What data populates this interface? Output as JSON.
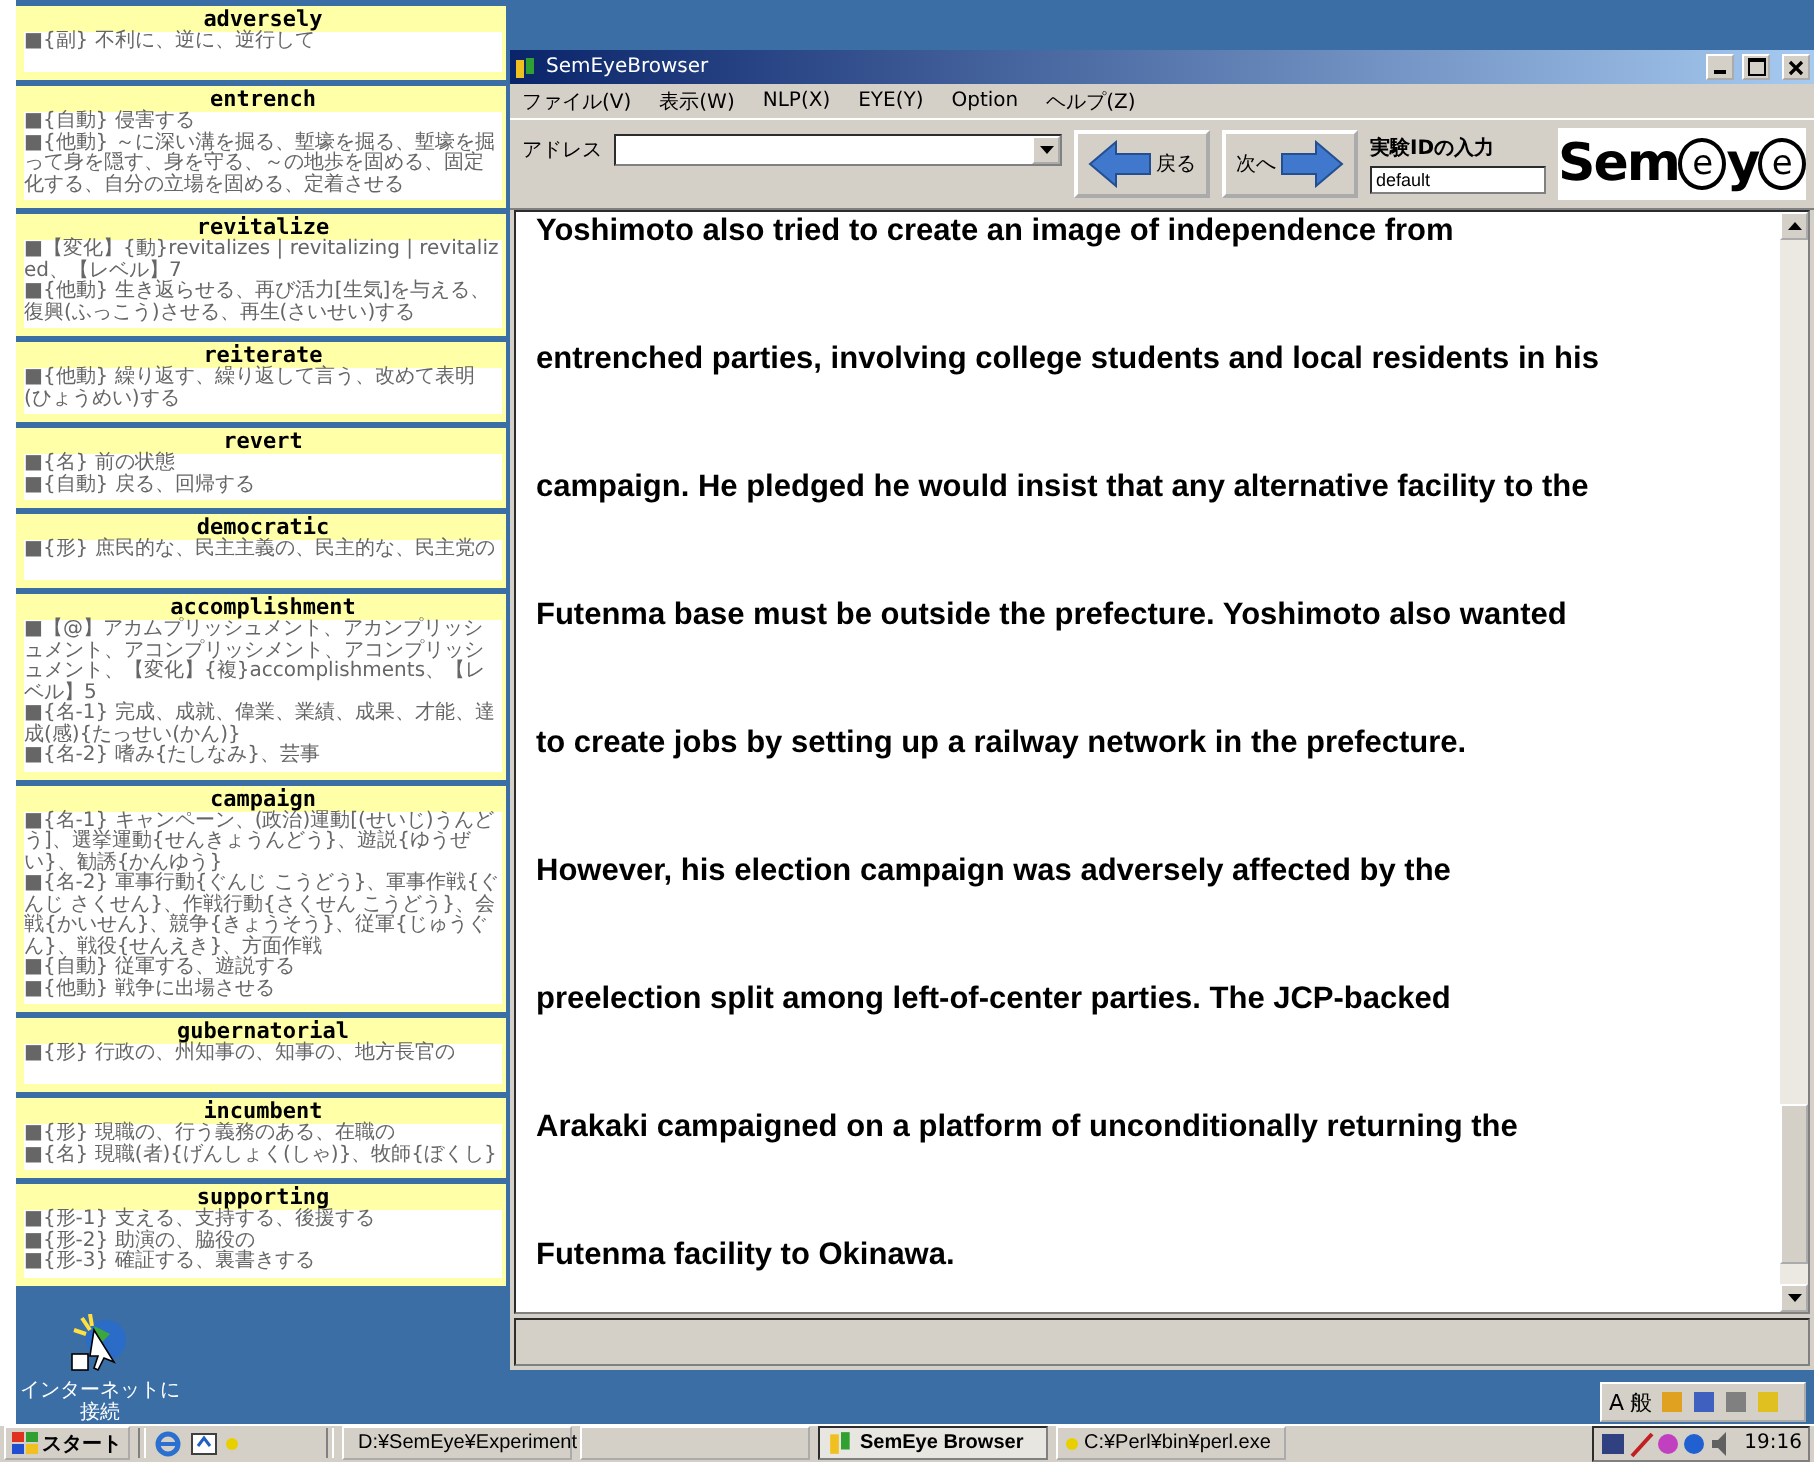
{
  "glossary_cards": [
    {
      "word": "adversely",
      "entries": [
        "■{副} 不利に、逆に、逆行して"
      ]
    },
    {
      "word": "entrench",
      "entries": [
        "■{自動} 侵害する",
        "■{他動} ～に深い溝を掘る、塹壕を掘る、塹壕を掘って身を隠す、身を守る、～の地歩を固める、固定化する、自分の立場を固める、定着させる"
      ]
    },
    {
      "word": "revitalize",
      "entries": [
        "■【変化】{動}revitalizes | revitalizing | revitalized、【レベル】7",
        "■{他動} 生き返らせる、再び活力[生気]を与える、復興(ふっこう)させる、再生(さいせい)する"
      ]
    },
    {
      "word": "reiterate",
      "entries": [
        "■{他動} 繰り返す、繰り返して言う、改めて表明(ひょうめい)する"
      ]
    },
    {
      "word": "revert",
      "entries": [
        "■{名} 前の状態",
        "■{自動} 戻る、回帰する"
      ]
    },
    {
      "word": "democratic",
      "entries": [
        "■{形} 庶民的な、民主主義の、民主的な、民主党の"
      ]
    },
    {
      "word": "accomplishment",
      "entries": [
        "■【@】アカムプリッシュメント、アカンプリッシュメント、アコンプリッシメント、アコンプリッシュメント、【変化】{複}accomplishments、【レベル】5",
        "■{名-1} 完成、成就、偉業、業績、成果、才能、達成(感){たっせい(かん)}",
        "■{名-2} 嗜み{たしなみ}、芸事"
      ]
    },
    {
      "word": "campaign",
      "entries": [
        "■{名-1} キャンペーン、(政治)運動[(せいじ)うんどう]、選挙運動{せんきょうんどう}、遊説{ゆうぜい}、勧誘{かんゆう}",
        "■{名-2} 軍事行動{ぐんじ こうどう}、軍事作戦{ぐんじ さくせん}、作戦行動{さくせん こうどう}、会戦{かいせん}、競争{きょうそう}、従軍{じゅうぐん}、戦役{せんえき}、方面作戦",
        "■{自動} 従軍する、遊説する",
        "■{他動} 戦争に出場させる"
      ]
    },
    {
      "word": "gubernatorial",
      "entries": [
        "■{形} 行政の、州知事の、知事の、地方長官の"
      ]
    },
    {
      "word": "incumbent",
      "entries": [
        "■{形} 現職の、行う義務のある、在職の",
        "■{名} 現職(者){げんしょく(しゃ)}、牧師{ぼくし}"
      ]
    },
    {
      "word": "supporting",
      "entries": [
        "■{形-1} 支える、支持する、後援する",
        "■{形-2} 助演の、脇役の",
        "■{形-3} 確証する、裏書きする"
      ]
    }
  ],
  "desktop_icon": {
    "label": "インターネットに接続"
  },
  "window": {
    "title": "SemEyeBrowser",
    "menu": [
      "ファイル(V)",
      "表示(W)",
      "NLP(X)",
      "EYE(Y)",
      "Option",
      "ヘルプ(Z)"
    ],
    "address": {
      "label": "アドレス"
    },
    "back_button": "戻る",
    "forward_button": "次へ",
    "experiment_id": {
      "label": "実験IDの入力",
      "value": "default"
    },
    "logo": [
      {
        "text": "Sem",
        "kind": "plain"
      },
      {
        "text": "e",
        "kind": "circled"
      },
      {
        "text": "y",
        "kind": "plain"
      },
      {
        "text": "e",
        "kind": "circled"
      }
    ],
    "text_lines": [
      "Yoshimoto also tried to create an image of independence from",
      "entrenched parties, involving college students and local residents in his",
      "campaign. He pledged he would insist that any alternative facility to the",
      "Futenma base must be outside the prefecture. Yoshimoto also wanted",
      "to create jobs by setting up a railway network in the prefecture.",
      "However, his election campaign was adversely affected by the",
      "preelection split among left-of-center parties. The JCP-backed",
      "Arakaki campaigned on a platform of unconditionally returning the",
      "Futenma facility to Okinawa."
    ]
  },
  "language_bar": [
    "A",
    "般"
  ],
  "taskbar": {
    "start": "スタート",
    "tasks": [
      {
        "kind": "folder",
        "label": "D:¥SemEye¥Experiment",
        "selected": false
      },
      {
        "kind": "blank",
        "selected": false
      },
      {
        "kind": "app",
        "label": "SemEye Browser",
        "selected": true
      },
      {
        "kind": "console",
        "label": "C:¥Perl¥bin¥perl.exe",
        "selected": false
      }
    ],
    "clock": "19:16"
  }
}
